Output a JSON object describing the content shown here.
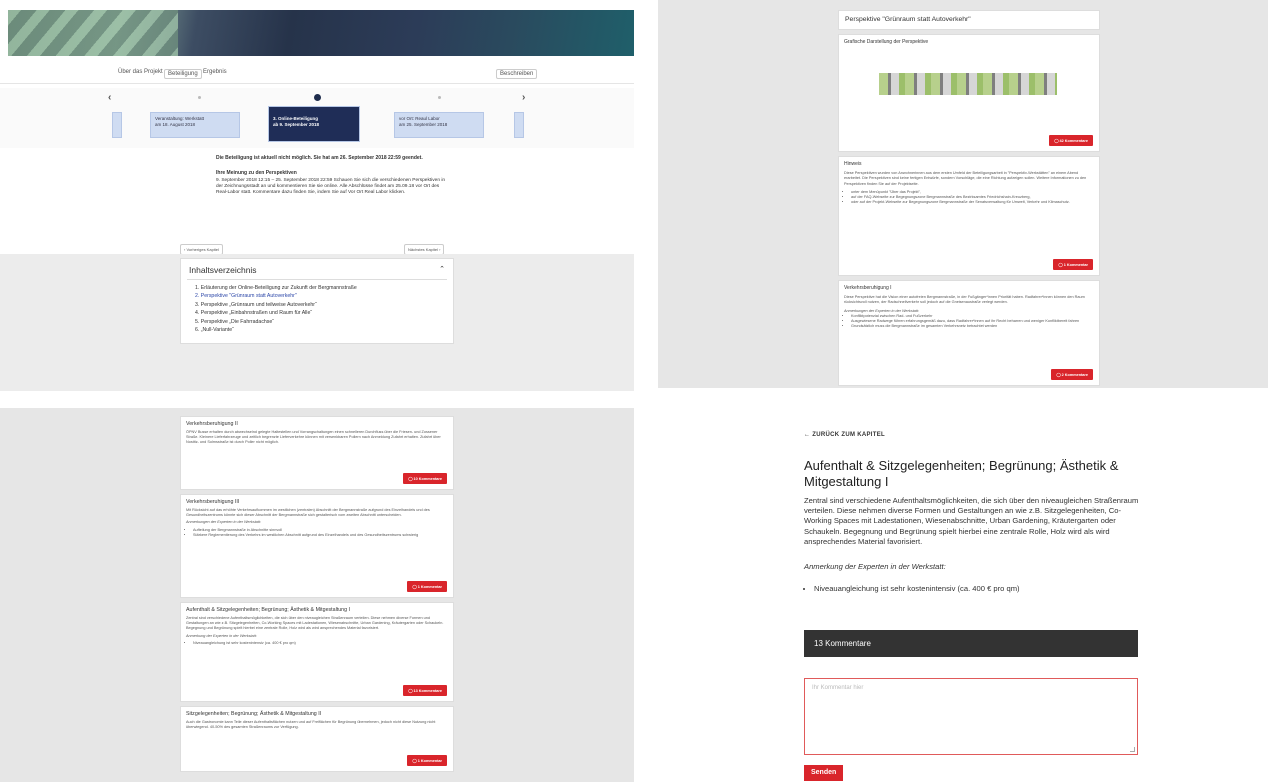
{
  "panel1": {
    "nav": {
      "about": "Über das Projekt",
      "participation": "Beteiligung",
      "results": "Ergebnis",
      "right": "Beschreiben"
    },
    "timeline": {
      "prev": "‹",
      "next": "›",
      "cards": [
        {
          "line1": "Veranstaltung: Werkstatt",
          "line2": "am 18. August 2018"
        },
        {
          "line1": "3. Online-Beteiligung",
          "line2": "ab 9. September 2018"
        },
        {
          "line1": "vor Ort: Reaul Labor",
          "line2": "am 25. September 2018"
        }
      ]
    },
    "info": {
      "closed": "Die Beteiligung ist aktuell nicht möglich. Sie hat am 26. September 2018 22:59 geendet.",
      "heading": "Ihre Meinung zu den Perspektiven",
      "text": "9. September 2018 12:15 – 25. September 2018 22:59 Schauen Sie sich die verschiedenen Perspektiven in der Zeichnungsstadt an und kommentieren Sie sie online. Alle Abschlüsse findet am 25.09.18 vor Ort des Real-Labor statt. Kommentare dazu finden Sie, indem Sie auf Vor Ort Real Labor klicken."
    },
    "prev_chapter": "‹ Vorheriges Kapitel",
    "next_chapter": "Nächstes Kapitel ›",
    "toc": {
      "title": "Inhaltsverzeichnis",
      "items": [
        "1. Erläuterung der Online-Beteiligung zur Zukunft der Bergmannstraße",
        "2. Perspektive \"Grünraum statt Autoverkehr\"",
        "3. Perspektive „Grünraum und teilweise Autoverkehr“",
        "4. Perspektive „Einbahnstraßen und Raum für Alle“",
        "5. Perspektive „Die Fahrradachse“",
        "6. „Null-Variante“"
      ]
    }
  },
  "panel2": {
    "title": "Perspektive \"Grünraum statt Autoverkehr\"",
    "graphic_heading": "Grafische Darstellung der Perspektive",
    "btn1": "◯ 42 Kommentare",
    "hint_heading": "Hinweis",
    "hint_text": "Diese Perspektiven wurden von Anwohnerinnen aus dem ersten Umfeld der Beteiligungsarbeit in \"Perspektiv-Werkstätten\" an einem Abend erarbeitet. Die Perspektiven sind keine fertigen Entwürfe, sondern Vorschläge, die eine Richtung aufzeigen sollen. Weitere Informationen zu den Perspektiven finden Sie auf der Projektseite.",
    "hint_list": [
      "unter dem Menüpunkt \"Über das Projekt\",",
      "auf der FAQ-Webseite zur Begegnungszone Bergmannstraße des Bezirksamtes Friedrichshain-Kreuzberg,",
      "oder auf der Projekt-Webseite zur Begegnungszone Bergmannstraße der Senatsverwaltung für Umwelt, Verkehr und Klimaschutz."
    ],
    "btn2": "◯ 1 Kommentar",
    "vb_heading": "Verkehrsberuhigung I",
    "vb_text": "Diese Perspektive hat die Vision einer autofreien Bergmannstraße, in der Fußgänger*innen Priorität haben. Radfahrer*innen können den Raum rücksichtsvoll nutzen, der Radschnellverkehr soll jedoch auf die Gneisenaustraße verlegt werden.",
    "vb_expert": "Anmerkungen der Experten in der Werkstatt:",
    "vb_list": [
      "Konfliktpotenzial zwischen Rad- und Fußverkehr",
      "Ausgewiesene Radwege führen erfahrungsgemäß dazu, dass Radfahrer*innen auf ihr Recht beharren und weniger Konfliktbereit fahren",
      "Grundsätzlich muss die Bergmannstraße im gesamten Verkehrsnetz betrachtet werden"
    ],
    "btn3": "◯ 2 Kommentare"
  },
  "panel3": {
    "blocks": [
      {
        "heading": "Verkehrsberuhigung II",
        "text": "ÖPNV Busse erhalten durch abwechselnd gelegte Haltestellen und Vorrangschaltungen einen schnelleren Durchfluss über die Friesen- und Zossener Straße. Kleinere Lieferfahrzeuge und zeitlich begrenzte Lieferverkehre können mit versenkbaren Pollern nach Anmeldung Zufahrt erhalten. Zufahrt über Nostitz- und Solmsstraße ist durch Poller nicht möglich.",
        "list": [],
        "btn": "◯ 10 Kommentare"
      },
      {
        "heading": "Verkehrsberuhigung III",
        "text": "Mit Rücksicht auf das erhöhte Verkehrsaufkommen im westlichen (zentralen) Abschnitt der Bergmannstraße aufgrund des Einzelhandels und des Gesundheitszentrums könnte sich dieser Abschnitt der Bergmannstraße sich gestalterisch vom zweiten Abschnitt unterscheiden.",
        "expert": "Anmerkungen der Experten in der Werkstatt:",
        "list": [
          "Aufteilung der Bergmannstraße in Abschnitte sinnvoll",
          "Stärkere Reglementierung des Verkehrs im westlichen Abschnitt aufgrund des Einzelhandels und des Gesundheitszentrums schwierig"
        ],
        "btn": "◯ 1 Kommentar"
      },
      {
        "heading": "Aufenthalt & Sitzgelegenheiten; Begrünung; Ästhetik & Mitgestaltung I",
        "text": "Zentral sind verschiedene Aufenthaltsmöglichkeiten, die sich über den niveaugleichen Straßenraum verteilen. Diese nehmen diverse Formen und Gestaltungen an wie z.B. Sitzgelegenheiten, Co-Working Spaces mit Ladestationen, Wiesenabschnitte, Urban Gardening, Kräutergarten oder Schaukeln. Begegnung und Begrünung spielt hierbei eine zentrale Rolle, Holz wird als wird ansprechendes Material favorisiert.",
        "expert": "Anmerkung der Experten in der Werkstatt:",
        "list": [
          "Niveauangleichung ist sehr kostenintensiv (ca. 400 € pro qm)"
        ],
        "btn": "◯ 13 Kommentare"
      },
      {
        "heading": "Sitzgelegenheiten; Begrünung; Ästhetik & Mitgestaltung II",
        "text": "Auch die Gastronomie kann Teile dieser Aufenthaltsflächen nutzen und auf Freiflächen für Begrünung übernehmen, jedoch nicht diese Nutzung nicht überwiegend. 40-50% des gesamten Straßenraums zur Verfügung.",
        "list": [],
        "btn": "◯ 1 Kommentar"
      }
    ]
  },
  "panel4": {
    "back": "← ZURÜCK ZUM KAPITEL",
    "title": "Aufenthalt & Sitzgelegenheiten; Begrünung; Ästhetik & Mitgestaltung I",
    "body": "Zentral sind verschiedene Aufenthaltsmöglichkeiten, die sich über den niveaugleichen Straßenraum verteilen. Diese nehmen diverse Formen und Gestaltungen an wie z.B. Sitzgelegenheiten, Co-Working Spaces mit Ladestationen, Wiesenabschnitte, Urban Gardening, Kräutergarten oder Schaukeln. Begegnung und Begrünung spielt hierbei eine zentrale Rolle, Holz wird als wird ansprechendes Material favorisiert.",
    "expert": "Anmerkung der Experten in der Werkstatt:",
    "bullet": "Niveauangleichung ist sehr kostenintensiv (ca. 400 € pro qm)",
    "comments_bar": "13 Kommentare",
    "placeholder": "Ihr Kommentar hier",
    "send": "Senden"
  },
  "colors": {
    "accent_red": "#d9252b",
    "navy": "#1f2d57",
    "link_blue": "#2b46a8",
    "dark_bar": "#333333"
  },
  "icons": [
    "chevron-left-icon",
    "chevron-right-icon",
    "chevron-up-icon",
    "comment-icon",
    "resize-grip-icon"
  ]
}
